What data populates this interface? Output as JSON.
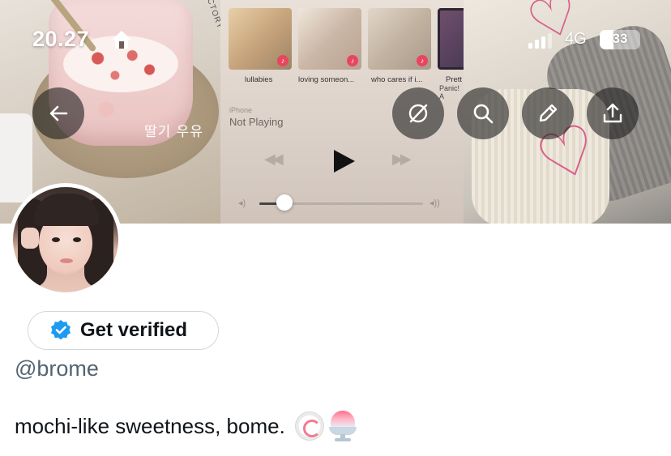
{
  "status_bar": {
    "time": "20.27",
    "network": "4G",
    "battery": "33"
  },
  "banner": {
    "cup_caption": "딸기 우유",
    "box_label": "ACTORY",
    "music_player": {
      "albums": [
        {
          "title": "lullabies"
        },
        {
          "title": "loving someon..."
        },
        {
          "title": "who cares if i..."
        },
        {
          "title": "Prett",
          "subtitle": "Panic! A"
        }
      ],
      "device": "iPhone",
      "status": "Not Playing",
      "volume": 0.15
    }
  },
  "profile": {
    "verify_label": "Get verified",
    "handle": "@brome",
    "bio": "mochi-like sweetness, bome."
  },
  "colors": {
    "accent_blue": "#1d9bf0",
    "secondary_text": "#536471"
  }
}
